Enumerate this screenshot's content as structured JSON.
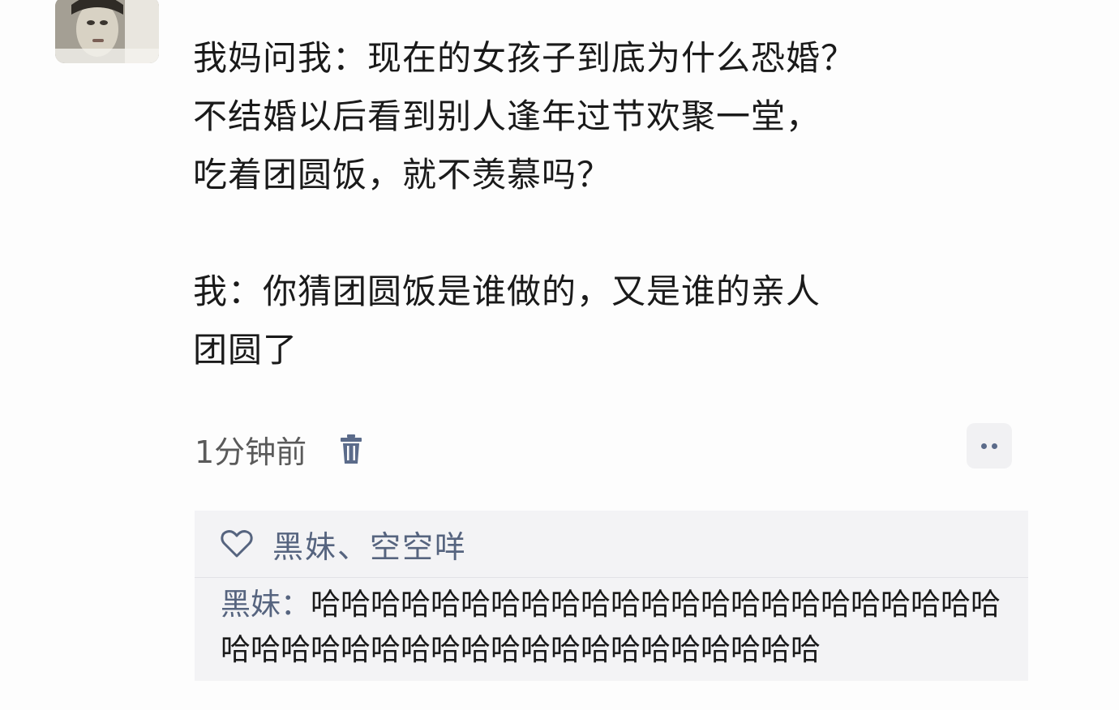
{
  "post": {
    "lines": [
      "我妈问我：现在的女孩子到底为什么恐婚？",
      "不结婚以后看到别人逢年过节欢聚一堂，",
      "吃着团圆饭，就不羡慕吗？",
      "我：你猜团圆饭是谁做的，又是谁的亲人",
      "团圆了"
    ]
  },
  "meta": {
    "timestamp": "1分钟前",
    "delete_icon": "trash-icon",
    "more_icon": "more-dots-icon"
  },
  "interaction": {
    "like_icon": "heart-icon",
    "likes": "黑妹、空空咩",
    "comments": [
      {
        "author": "黑妹",
        "separator": "：",
        "text": "哈哈哈哈哈哈哈哈哈哈哈哈哈哈哈哈哈哈哈哈哈哈哈哈哈哈哈哈哈哈哈哈哈哈哈哈哈哈哈哈哈哈哈"
      }
    ]
  },
  "colors": {
    "link": "#56647f",
    "panel": "#f3f3f5",
    "text": "#1a1a1a",
    "meta": "#5a5a5a"
  }
}
